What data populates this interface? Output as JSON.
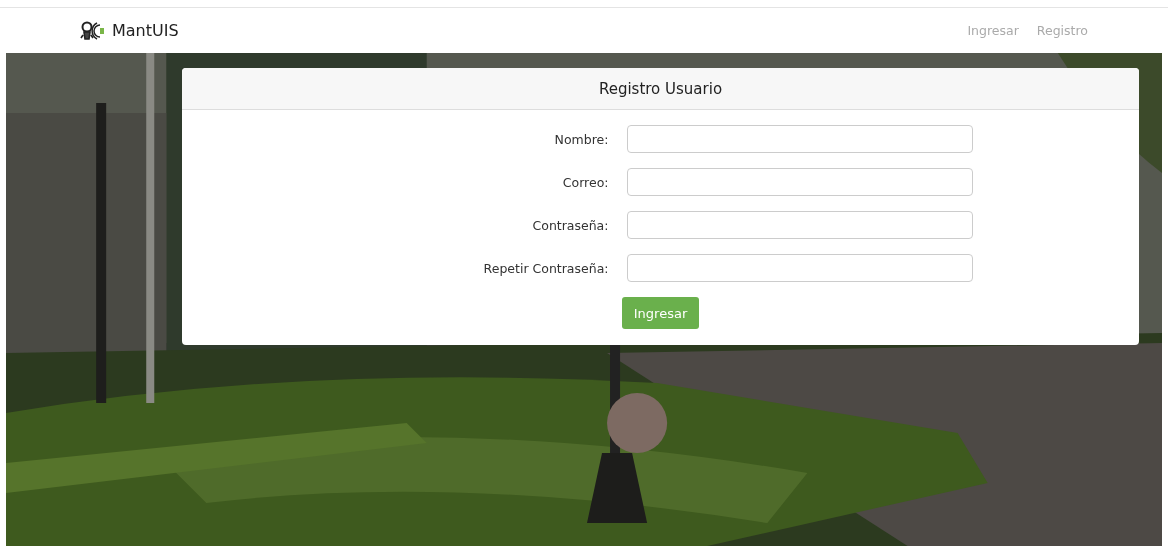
{
  "navbar": {
    "brand": "MantUIS",
    "links": [
      {
        "label": "Ingresar",
        "selected": false
      },
      {
        "label": "Registro",
        "selected": false
      }
    ]
  },
  "form": {
    "title": "Registro Usuario",
    "fields": [
      {
        "label": "Nombre:"
      },
      {
        "label": "Correo:"
      },
      {
        "label": "Contraseña:"
      },
      {
        "label": "Repetir Contraseña:"
      }
    ],
    "submit": "Ingresar"
  }
}
